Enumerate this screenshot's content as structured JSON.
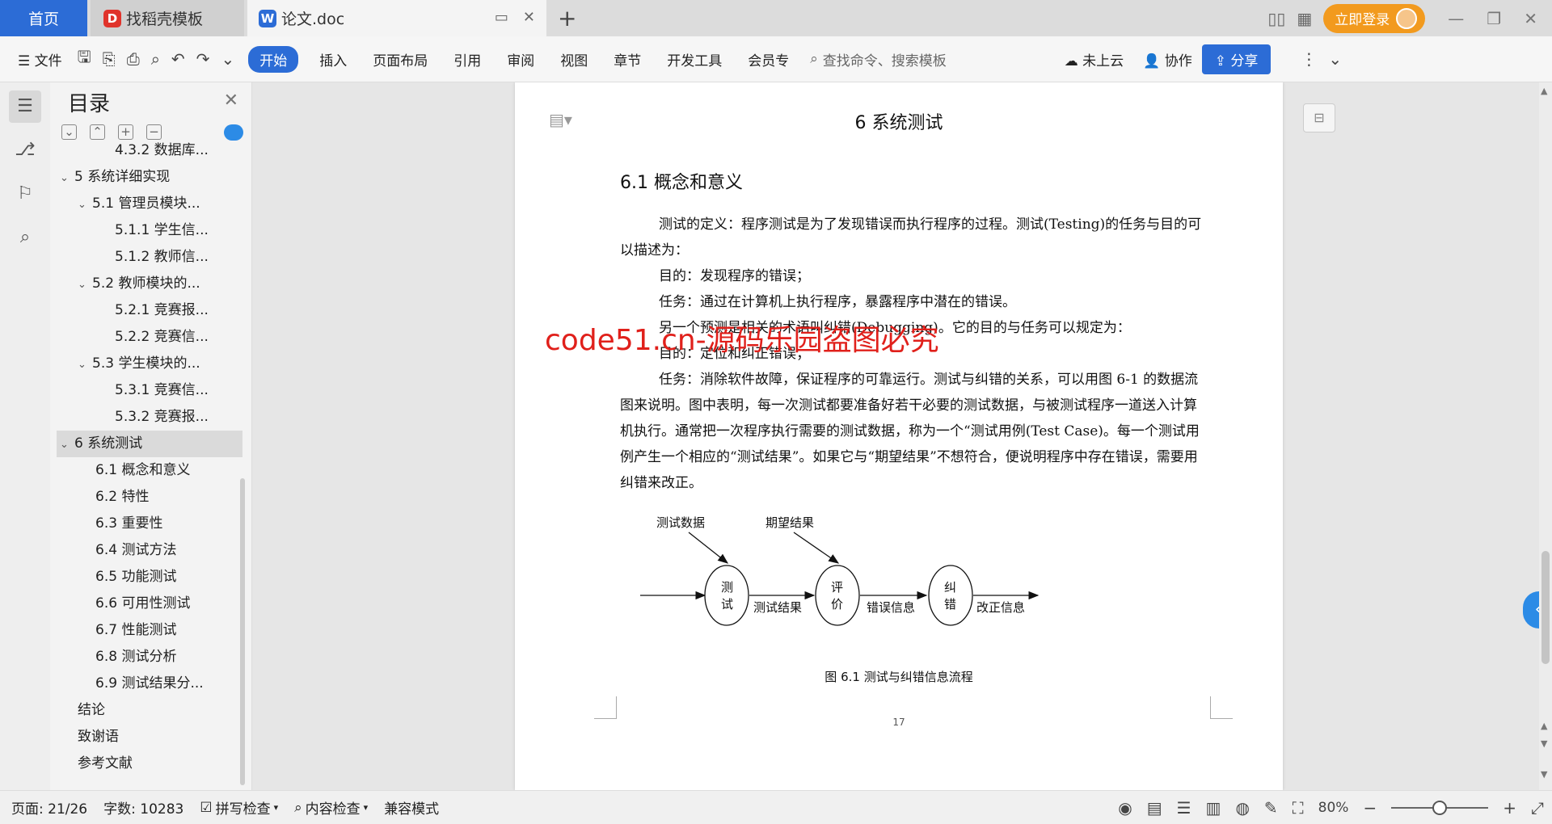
{
  "tabs": {
    "home": "首页",
    "templates": "找稻壳模板",
    "doc": "论文.doc",
    "doc_icon": "W"
  },
  "header": {
    "login_label": "立即登录"
  },
  "menu": {
    "file": "文件",
    "start": "开始",
    "insert": "插入",
    "layout": "页面布局",
    "reference": "引用",
    "review": "审阅",
    "view": "视图",
    "chapter": "章节",
    "dev": "开发工具",
    "member": "会员专",
    "search": "查找命令、搜索模板",
    "cloud": "未上云",
    "collab": "协作",
    "share": "分享"
  },
  "outline": {
    "title": "目录",
    "items": [
      {
        "label": "4.3.2 数据库...",
        "level": 3
      },
      {
        "label": "5 系统详细实现",
        "level": 1
      },
      {
        "label": "5.1 管理员模块...",
        "level": 2
      },
      {
        "label": "5.1.1 学生信...",
        "level": 3
      },
      {
        "label": "5.1.2 教师信...",
        "level": 3
      },
      {
        "label": "5.2 教师模块的...",
        "level": 2
      },
      {
        "label": "5.2.1 竞赛报...",
        "level": 3
      },
      {
        "label": "5.2.2 竞赛信...",
        "level": 3
      },
      {
        "label": "5.3 学生模块的...",
        "level": 2
      },
      {
        "label": "5.3.1 竞赛信...",
        "level": 3
      },
      {
        "label": "5.3.2 竞赛报...",
        "level": 3
      },
      {
        "label": "6 系统测试",
        "level": 1,
        "selected": true
      },
      {
        "label": "6.1 概念和意义",
        "level": 2
      },
      {
        "label": "6.2 特性",
        "level": 2
      },
      {
        "label": "6.3 重要性",
        "level": 2
      },
      {
        "label": "6.4 测试方法",
        "level": 2
      },
      {
        "label": "6.5 功能测试",
        "level": 2
      },
      {
        "label": "6.6 可用性测试",
        "level": 2
      },
      {
        "label": "6.7 性能测试",
        "level": 2
      },
      {
        "label": "6.8 测试分析",
        "level": 2
      },
      {
        "label": "6.9 测试结果分...",
        "level": 2
      },
      {
        "label": "结论",
        "level": 1
      },
      {
        "label": "致谢语",
        "level": 1
      },
      {
        "label": "参考文献",
        "level": 1
      }
    ]
  },
  "document": {
    "chapter_title": "6 系统测试",
    "section_title": "6.1 概念和意义",
    "paragraphs": [
      "测试的定义：程序测试是为了发现错误而执行程序的过程。测试(Testing)的任务与目的可以描述为：",
      "目的：发现程序的错误；",
      "任务：通过在计算机上执行程序，暴露程序中潜在的错误。",
      "另一个预测是相关的术语叫纠错(Debugging)。它的目的与任务可以规定为：",
      "目的：定位和纠正错误；",
      "任务：消除软件故障，保证程序的可靠运行。测试与纠错的关系，可以用图 6-1 的数据流图来说明。图中表明，每一次测试都要准备好若干必要的测试数据，与被测试程序一道送入计算机执行。通常把一次程序执行需要的测试数据，称为一个“测试用例(Test Case)。每一个测试用例产生一个相应的“测试结果”。如果它与“期望结果”不想符合，便说明程序中存在错误，需要用纠错来改正。"
    ],
    "figure": {
      "input_top_1": "测试数据",
      "input_top_2": "期望结果",
      "node_1": [
        "测",
        "试"
      ],
      "node_2": [
        "评",
        "价"
      ],
      "node_3": [
        "纠",
        "错"
      ],
      "edge_1": "测试结果",
      "edge_2": "错误信息",
      "edge_3": "改正信息",
      "caption": "图 6.1 测试与纠错信息流程"
    },
    "page_number": "17",
    "watermark": "code51.cn-源码乐园盗图必究"
  },
  "status": {
    "page": "页面: 21/26",
    "words": "字数: 10283",
    "spell": "拼写检查",
    "content": "内容检查",
    "compat": "兼容模式",
    "zoom": "80%",
    "zoom_level": 0.5
  },
  "colors": {
    "accent": "#2c6cd6",
    "login": "#f29a1e",
    "watermark": "#e0201b"
  }
}
